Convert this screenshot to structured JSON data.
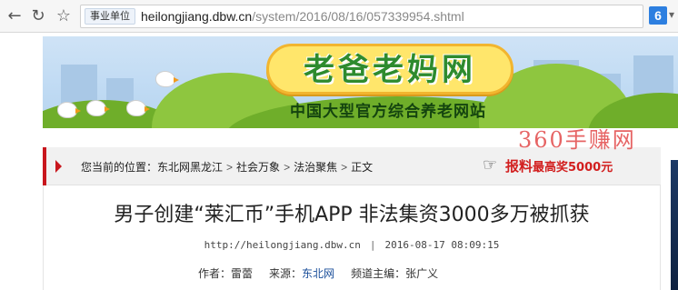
{
  "browser": {
    "site_tag": "事业单位",
    "url_host": "heilongjiang.dbw.cn",
    "url_path": "/system/2016/08/16/057339954.shtml",
    "extension_badge": "6",
    "icons": [
      "back-icon",
      "reload-icon",
      "star-icon",
      "extension-icon"
    ]
  },
  "banner": {
    "logo_text": "老爸老妈网",
    "subtitle": "中国大型官方综合养老网站"
  },
  "breadcrumb": {
    "prefix": "您当前的位置：",
    "items": [
      "东北网黑龙江",
      "社会万象",
      "法治聚焦",
      "正文"
    ],
    "separator": ">"
  },
  "tip": {
    "label": "报料",
    "prize": "最高奖5000元"
  },
  "watermark": "360手赚网",
  "article": {
    "title": "男子创建“莱汇币”手机APP 非法集资3000多万被抓获",
    "source_url": "http://heilongjiang.dbw.cn",
    "divider": "|",
    "datetime": "2016-08-17 08:09:15",
    "author_label": "作者：",
    "author": "雷蕾",
    "source_label": "来源：",
    "source": "东北网",
    "editor_label": "频道主编：",
    "editor": "张广义"
  },
  "colors": {
    "accent_red": "#c8161d",
    "logo_green": "#2e8b2e",
    "banner_sky": "#cfe3f6"
  }
}
